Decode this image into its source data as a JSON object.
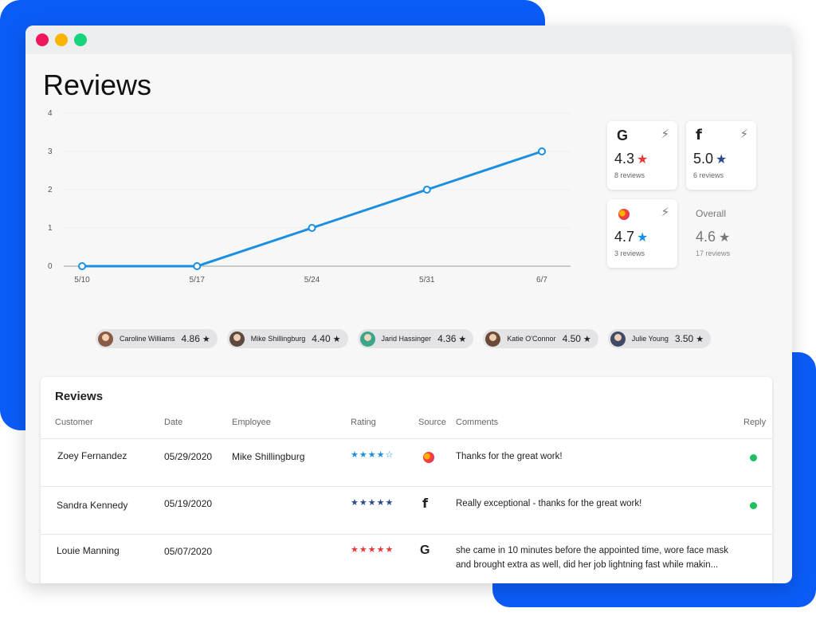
{
  "page": {
    "title": "Reviews"
  },
  "colors": {
    "accent_blue": "#0b5cf7",
    "line": "#1b8fe0",
    "google_star": "#e53935",
    "facebook_star": "#2c4a8c",
    "yelp_star": "#1b8fe0",
    "overall_star": "#777777",
    "reply_dot": "#1fbf5f",
    "traffic_red": "#f0185a",
    "traffic_yellow": "#f7b500",
    "traffic_green": "#15d47a"
  },
  "chart_data": {
    "type": "line",
    "x": [
      "5/10",
      "5/17",
      "5/24",
      "5/31",
      "6/7"
    ],
    "values": [
      0,
      0,
      1,
      2,
      3
    ],
    "ylim": [
      0,
      4
    ],
    "yticks": [
      "0",
      "1",
      "2",
      "3",
      "4"
    ],
    "grid": true
  },
  "sources": [
    {
      "icon": "google-icon",
      "letter": "G",
      "rating": "4.3",
      "count": "8 reviews",
      "star_color": "#e53935"
    },
    {
      "icon": "facebook-icon",
      "letter": "f",
      "rating": "5.0",
      "count": "6 reviews",
      "star_color": "#2c4a8c"
    },
    {
      "icon": "yelp-icon",
      "letter": "",
      "rating": "4.7",
      "count": "3 reviews",
      "star_color": "#1b8fe0"
    }
  ],
  "overall": {
    "label": "Overall",
    "rating": "4.6",
    "count": "17 reviews"
  },
  "employees": [
    {
      "name": "Caroline Williams",
      "score": "4.86",
      "avatar_color": "#8a5a44"
    },
    {
      "name": "Mike Shillingburg",
      "score": "4.40",
      "avatar_color": "#5a4a40"
    },
    {
      "name": "Jarid Hassinger",
      "score": "4.36",
      "avatar_color": "#3aa58a"
    },
    {
      "name": "Katie O'Connor",
      "score": "4.50",
      "avatar_color": "#6b4a3a"
    },
    {
      "name": "Julie Young",
      "score": "3.50",
      "avatar_color": "#3e4a66"
    }
  ],
  "reviews": {
    "title": "Reviews",
    "columns": [
      "Customer",
      "Date",
      "Employee",
      "Rating",
      "Source",
      "Comments",
      "Reply"
    ],
    "rows": [
      {
        "customer": "Zoey Fernandez",
        "date": "05/29/2020",
        "employee": "Mike Shillingburg",
        "stars": "★★★★☆",
        "star_color": "#1b8fe0",
        "source": "yelp-icon",
        "source_letter": "",
        "comment": "Thanks for the great work!",
        "reply": true
      },
      {
        "customer": "Sandra Kennedy",
        "date": "05/19/2020",
        "employee": "",
        "stars": "★★★★★",
        "star_color": "#2c4a8c",
        "source": "facebook-icon",
        "source_letter": "f",
        "comment": "Really exceptional - thanks for the great work!",
        "reply": true
      },
      {
        "customer": "Louie Manning",
        "date": "05/07/2020",
        "employee": "",
        "stars": "★★★★★",
        "star_color": "#e53935",
        "source": "google-icon",
        "source_letter": "G",
        "comment": "she came in 10 minutes before the appointed time, wore face mask and brought extra as well, did her job lightning fast while makin...",
        "reply": false
      }
    ]
  },
  "icons": {
    "bolt": "⚡",
    "star": "★"
  }
}
